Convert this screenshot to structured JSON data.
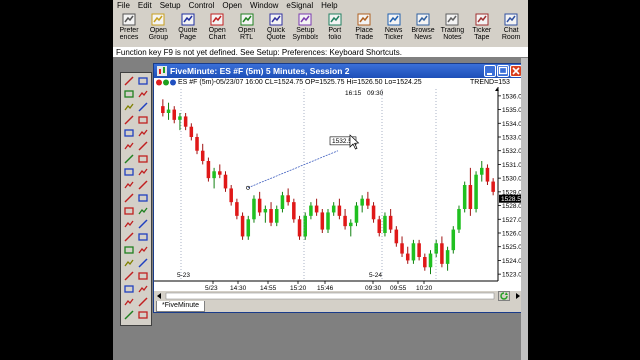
{
  "menu": [
    "File",
    "Edit",
    "Setup",
    "Control",
    "Open",
    "Window",
    "eSignal",
    "Help"
  ],
  "toolbar": [
    {
      "l1": "Prefer",
      "l2": "ences",
      "icon": "preferences-icon",
      "color": "#555"
    },
    {
      "l1": "Open",
      "l2": "Group",
      "icon": "open-group-icon",
      "color": "#c8a020"
    },
    {
      "l1": "Quote",
      "l2": "Page",
      "icon": "quote-page-icon",
      "color": "#2030a0"
    },
    {
      "l1": "Open",
      "l2": "Chart",
      "icon": "open-chart-icon",
      "color": "#c02020"
    },
    {
      "l1": "Open",
      "l2": "RTL",
      "icon": "open-rtl-icon",
      "color": "#208020"
    },
    {
      "l1": "Quick",
      "l2": "Quote",
      "icon": "quick-quote-icon",
      "color": "#3030a0"
    },
    {
      "l1": "Setup",
      "l2": "Symbols",
      "icon": "setup-symbols-icon",
      "color": "#7a3ab0"
    },
    {
      "l1": "Port",
      "l2": "folio",
      "icon": "portfolio-icon",
      "color": "#208060"
    },
    {
      "l1": "Place",
      "l2": "Trade",
      "icon": "place-trade-icon",
      "color": "#b06020"
    },
    {
      "l1": "News",
      "l2": "Ticker",
      "icon": "news-ticker-icon",
      "color": "#2060b0"
    },
    {
      "l1": "Browse",
      "l2": "News",
      "icon": "browse-news-icon",
      "color": "#3060a0"
    },
    {
      "l1": "Trading",
      "l2": "Notes",
      "icon": "trading-notes-icon",
      "color": "#606060"
    },
    {
      "l1": "Ticker",
      "l2": "Tape",
      "icon": "ticker-tape-icon",
      "color": "#a03030"
    },
    {
      "l1": "Chat",
      "l2": "Room",
      "icon": "chat-room-icon",
      "color": "#3050a0"
    }
  ],
  "status_line": "Function key F9 is not yet defined. See Setup: Preferences: Keyboard Shortcuts.",
  "window": {
    "title": "FiveMinute: ES #F (5m) 5 Minutes, Session 2",
    "info": "ES #F (5m)-05/23/07 16:00 CL=1524.75 OP=1525.75 Hi=1526.50 Lo=1524.25",
    "trend_label": "TREND=153",
    "tab_label": "*FiveMinute"
  },
  "chart_data": {
    "type": "candlestick",
    "ylim": [
      1522.5,
      1536.5
    ],
    "y_ticks": [
      1536,
      1535,
      1534,
      1533,
      1532,
      1531,
      1530,
      1529,
      1528,
      1527,
      1526,
      1525,
      1524,
      1523
    ],
    "y_tick_labels": [
      "1536.00",
      "1535.00",
      "1534.00",
      "1533.00",
      "1532.00",
      "1531.00",
      "1530.00",
      "1529.00",
      "1528.00",
      "1527.00",
      "1526.00",
      "1525.00",
      "1524.00",
      "1523.00"
    ],
    "x_tick_labels": [
      "5/23",
      "14:30",
      "14:55",
      "15:20",
      "15:46",
      "09:30",
      "09:55",
      "10:20"
    ],
    "top_labels": [
      "16:15",
      "09:30"
    ],
    "date_labels": [
      "5-23",
      "5-24"
    ],
    "crosshair_value": "1532.50",
    "current_price_label": "1528.50",
    "up_color": "#20c020",
    "down_color": "#e01818",
    "candles": [
      [
        1535.25,
        1535.75,
        1534.5,
        1534.75
      ],
      [
        1534.75,
        1535.5,
        1534.25,
        1535.0
      ],
      [
        1535.0,
        1535.25,
        1534.0,
        1534.25
      ],
      [
        1534.25,
        1534.75,
        1533.5,
        1534.5
      ],
      [
        1534.5,
        1534.75,
        1533.5,
        1533.75
      ],
      [
        1533.75,
        1534.0,
        1532.75,
        1533.0
      ],
      [
        1533.0,
        1533.25,
        1531.75,
        1532.0
      ],
      [
        1532.0,
        1532.5,
        1531.0,
        1531.25
      ],
      [
        1531.25,
        1531.5,
        1529.75,
        1530.0
      ],
      [
        1530.0,
        1530.75,
        1529.25,
        1530.5
      ],
      [
        1530.5,
        1531.0,
        1530.0,
        1530.25
      ],
      [
        1530.25,
        1530.5,
        1529.0,
        1529.25
      ],
      [
        1529.25,
        1529.5,
        1528.0,
        1528.25
      ],
      [
        1528.25,
        1528.5,
        1527.0,
        1527.25
      ],
      [
        1527.25,
        1527.5,
        1525.5,
        1525.75
      ],
      [
        1525.75,
        1527.25,
        1525.5,
        1527.0
      ],
      [
        1527.0,
        1528.75,
        1526.75,
        1528.5
      ],
      [
        1528.5,
        1529.0,
        1527.25,
        1527.5
      ],
      [
        1527.5,
        1528.0,
        1526.75,
        1527.75
      ],
      [
        1527.75,
        1528.25,
        1526.5,
        1526.75
      ],
      [
        1526.75,
        1528.0,
        1526.5,
        1527.75
      ],
      [
        1527.75,
        1529.0,
        1527.5,
        1528.75
      ],
      [
        1528.75,
        1529.25,
        1528.0,
        1528.25
      ],
      [
        1528.25,
        1528.5,
        1526.75,
        1527.0
      ],
      [
        1527.0,
        1527.25,
        1525.5,
        1525.75
      ],
      [
        1525.75,
        1527.5,
        1525.5,
        1527.25
      ],
      [
        1527.25,
        1528.25,
        1527.0,
        1528.0
      ],
      [
        1528.0,
        1528.5,
        1527.25,
        1527.5
      ],
      [
        1527.5,
        1527.75,
        1526.0,
        1526.25
      ],
      [
        1526.25,
        1527.75,
        1526.0,
        1527.5
      ],
      [
        1527.5,
        1528.25,
        1527.25,
        1528.0
      ],
      [
        1528.0,
        1528.5,
        1527.0,
        1527.25
      ],
      [
        1527.25,
        1527.75,
        1526.25,
        1526.5
      ],
      [
        1526.5,
        1527.0,
        1525.75,
        1526.75
      ],
      [
        1526.75,
        1528.25,
        1526.5,
        1528.0
      ],
      [
        1528.0,
        1528.75,
        1527.5,
        1528.5
      ],
      [
        1528.5,
        1529.0,
        1527.75,
        1528.0
      ],
      [
        1528.0,
        1528.25,
        1526.75,
        1527.0
      ],
      [
        1527.0,
        1527.25,
        1525.75,
        1526.0
      ],
      [
        1526.0,
        1527.5,
        1525.75,
        1527.25
      ],
      [
        1527.25,
        1527.75,
        1526.0,
        1526.25
      ],
      [
        1526.25,
        1526.5,
        1525.0,
        1525.25
      ],
      [
        1525.25,
        1525.75,
        1524.25,
        1524.5
      ],
      [
        1524.5,
        1525.0,
        1523.75,
        1524.0
      ],
      [
        1524.0,
        1525.5,
        1523.75,
        1525.25
      ],
      [
        1525.25,
        1525.5,
        1524.0,
        1524.25
      ],
      [
        1524.25,
        1524.5,
        1523.25,
        1523.5
      ],
      [
        1523.5,
        1524.75,
        1523.0,
        1524.5
      ],
      [
        1524.5,
        1525.5,
        1524.25,
        1525.25
      ],
      [
        1525.25,
        1525.75,
        1523.5,
        1523.75
      ],
      [
        1523.75,
        1525.0,
        1523.25,
        1524.75
      ],
      [
        1524.75,
        1526.5,
        1524.5,
        1526.25
      ],
      [
        1526.25,
        1528.0,
        1526.0,
        1527.75
      ],
      [
        1527.75,
        1529.75,
        1527.5,
        1529.5
      ],
      [
        1529.5,
        1530.75,
        1527.25,
        1527.75
      ],
      [
        1527.75,
        1530.5,
        1527.5,
        1530.25
      ],
      [
        1530.25,
        1531.25,
        1529.75,
        1530.75
      ],
      [
        1530.75,
        1531.0,
        1529.5,
        1529.75
      ],
      [
        1529.75,
        1530.0,
        1528.75,
        1529.0
      ]
    ]
  }
}
